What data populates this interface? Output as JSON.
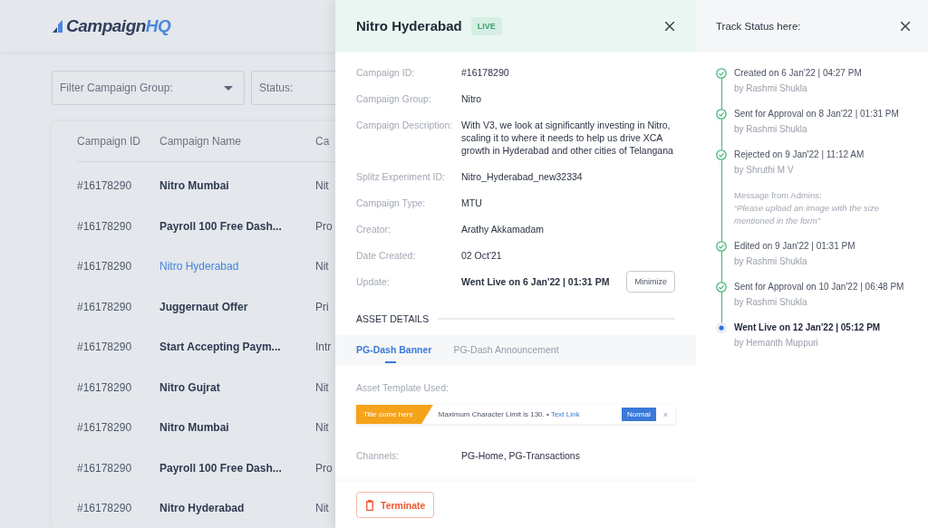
{
  "header": {
    "logo": {
      "text": "Campaign",
      "accent": "HQ"
    }
  },
  "filters": [
    {
      "placeholder": "Filter Campaign Group:",
      "dropdown": true
    },
    {
      "placeholder": "Status:"
    }
  ],
  "table": {
    "columns": [
      "Campaign ID",
      "Campaign Name",
      "Ca"
    ],
    "rows": [
      {
        "id": "#16178290",
        "name": "Nitro Mumbai",
        "column_3": "Nit",
        "selected": false
      },
      {
        "id": "#16178290",
        "name": "Payroll 100 Free Dash...",
        "column_3": "Pro",
        "selected": false
      },
      {
        "id": "#16178290",
        "name": "Nitro Hyderabad",
        "column_3": "Nit",
        "selected": true
      },
      {
        "id": "#16178290",
        "name": "Juggernaut Offer",
        "column_3": "Pri",
        "selected": false
      },
      {
        "id": "#16178290",
        "name": "Start Accepting Paym...",
        "column_3": "Intr",
        "selected": false
      },
      {
        "id": "#16178290",
        "name": "Nitro Gujrat",
        "column_3": "Nit",
        "selected": false
      },
      {
        "id": "#16178290",
        "name": "Nitro Mumbai",
        "column_3": "Nit",
        "selected": false
      },
      {
        "id": "#16178290",
        "name": "Payroll 100 Free Dash...",
        "column_3": "Pro",
        "selected": false
      },
      {
        "id": "#16178290",
        "name": "Nitro Hyderabad",
        "column_3": "Nit",
        "selected": false
      }
    ]
  },
  "detail": {
    "title": "Nitro Hyderabad",
    "badge": "LIVE",
    "fields": [
      {
        "label": "Campaign ID:",
        "value": "#16178290"
      },
      {
        "label": "Campaign Group:",
        "value": "Nitro"
      },
      {
        "label": "Campaign Description:",
        "value": "With V3, we look at significantly investing in Nitro, scaling it to where it needs to help us drive XCA growth in Hyderabad and other cities of Telangana"
      },
      {
        "label": "Splitz Experiment ID:",
        "value": "Nitro_Hyderabad_new32334"
      },
      {
        "label": "Campaign Type:",
        "value": "MTU"
      },
      {
        "label": "Creator:",
        "value": "Arathy Akkamadam"
      },
      {
        "label": "Date Created:",
        "value": "02 Oct'21"
      },
      {
        "label": "Update:",
        "value": "Went Live on 6 Jan'22 | 01:31 PM",
        "button": "Minimize"
      }
    ],
    "section_title": "ASSET DETAILS",
    "tabs": [
      {
        "label": "PG-Dash Banner",
        "selected": true
      },
      {
        "label": "PG-Dash Announcement",
        "selected": false
      }
    ],
    "template_label": "Asset Template Used:",
    "template": {
      "title": "Title come here",
      "text": "Maximum Character Limit is 130. •",
      "link": "Text Link",
      "button": "Normal",
      "close": "×"
    },
    "channels": {
      "label": "Channels:",
      "value": "PG-Home, PG-Transactions"
    },
    "footer_button": "Terminate"
  },
  "track": {
    "title": "Track Status here:",
    "events": [
      {
        "kind": "done",
        "title": "Created on 6 Jan'22 | 04:27 PM",
        "by": "by Rashmi Shukla"
      },
      {
        "kind": "done",
        "title": "Sent for Approval on 8 Jan'22 | 01:31 PM",
        "by": "by Rashmi Shukla"
      },
      {
        "kind": "done",
        "title": "Rejected on 9 Jan'22 | 11:12 AM",
        "by": "by Shruthi M V",
        "message_label": "Message from Admins:",
        "message": "“Please upload an image with the size mentioned in the form”"
      },
      {
        "kind": "done",
        "title": "Edited on 9 Jan'22 | 01:31 PM",
        "by": "by Rashmi Shukla"
      },
      {
        "kind": "done",
        "title": "Sent for Approval on 10 Jan'22 | 06:48 PM",
        "by": "by Rashmi Shukla"
      },
      {
        "kind": "current",
        "title": "Went Live on 12 Jan'22 | 05:12 PM",
        "by": "by Hemanth Muppuri"
      }
    ]
  }
}
